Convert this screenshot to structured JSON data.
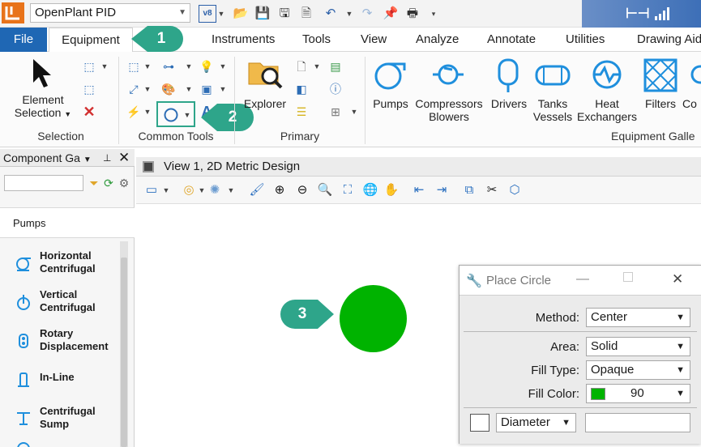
{
  "app": {
    "workspace": "OpenPlant PID",
    "logo_text": "L̅"
  },
  "tabs": [
    "File",
    "Equipment",
    "Instruments",
    "Tools",
    "View",
    "Analyze",
    "Annotate",
    "Utilities",
    "Drawing Aids"
  ],
  "ribbon": {
    "element_selection": {
      "line1": "Element",
      "line2": "Selection"
    },
    "groups": {
      "selection": "Selection",
      "common_tools": "Common Tools",
      "primary": "Primary",
      "equipment_gallery": "Equipment Galle"
    },
    "explorer": "Explorer",
    "gallery": [
      {
        "line1": "Pumps",
        "line2": ""
      },
      {
        "line1": "Compressors",
        "line2": "Blowers"
      },
      {
        "line1": "Drivers",
        "line2": ""
      },
      {
        "line1": "Tanks",
        "line2": "Vessels"
      },
      {
        "line1": "Heat",
        "line2": "Exchangers"
      },
      {
        "line1": "Filters",
        "line2": ""
      },
      {
        "line1": "Co",
        "line2": ""
      }
    ]
  },
  "callouts": [
    "1",
    "2",
    "3"
  ],
  "component_gallery": {
    "title": "Component Ga",
    "search_value": "",
    "section": "Pumps",
    "items": [
      {
        "line1": "Horizontal",
        "line2": "Centrifugal"
      },
      {
        "line1": "Vertical",
        "line2": "Centrifugal"
      },
      {
        "line1": "Rotary",
        "line2": "Displacement"
      },
      {
        "line1": "In-Line",
        "line2": ""
      },
      {
        "line1": "Centrifugal",
        "line2": "Sump"
      }
    ]
  },
  "view": {
    "title": "View 1, 2D Metric Design",
    "placed_circle_color": "#00b300"
  },
  "place_circle": {
    "title": "Place Circle",
    "method_label": "Method:",
    "method_value": "Center",
    "area_label": "Area:",
    "area_value": "Solid",
    "fill_type_label": "Fill Type:",
    "fill_type_value": "Opaque",
    "fill_color_label": "Fill Color:",
    "fill_color_value": "90",
    "fill_color_swatch": "#00b300",
    "dimension_mode": "Diameter",
    "dimension_value": ""
  },
  "colors": {
    "file_tab": "#1f67b4",
    "callout": "#2ea58a",
    "accent_blue": "#2d6db5"
  }
}
